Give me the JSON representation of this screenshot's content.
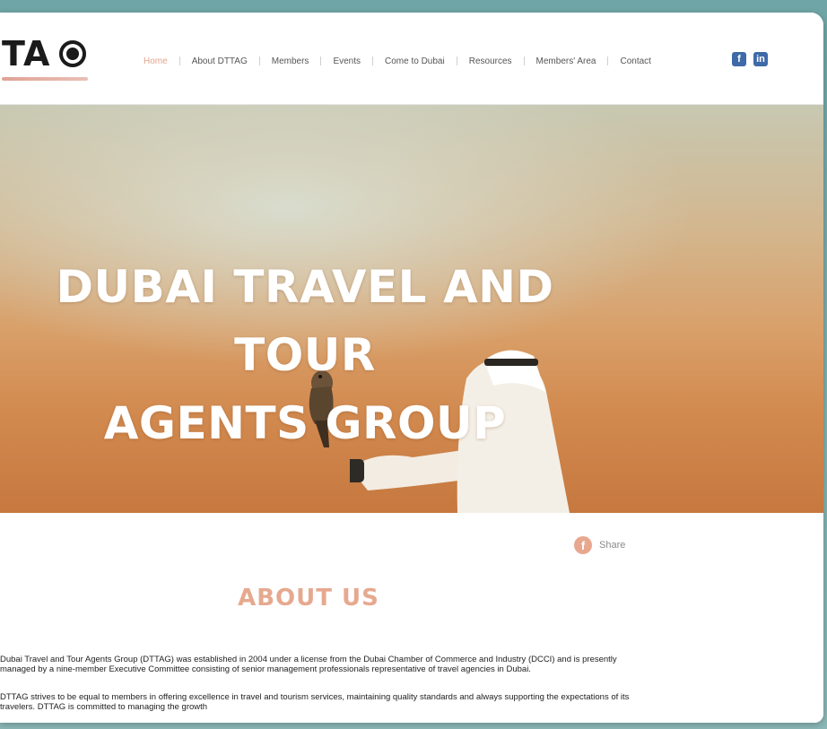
{
  "header": {
    "logo_text": "TA",
    "nav": [
      {
        "label": "Home",
        "active": true
      },
      {
        "label": "About DTTAG",
        "active": false
      },
      {
        "label": "Members",
        "active": false
      },
      {
        "label": "Events",
        "active": false
      },
      {
        "label": "Come to Dubai",
        "active": false
      },
      {
        "label": "Resources",
        "active": false
      },
      {
        "label": "Members' Area",
        "active": false
      },
      {
        "label": "Contact",
        "active": false
      }
    ],
    "social": [
      {
        "icon": "facebook-icon",
        "glyph": "f"
      },
      {
        "icon": "linkedin-icon",
        "glyph": "in"
      }
    ]
  },
  "hero": {
    "title_line1": "DUBAI TRAVEL AND TOUR",
    "title_line2": "AGENTS GROUP"
  },
  "content": {
    "share_label": "Share",
    "share_glyph": "f",
    "about_title": "ABOUT US",
    "paragraph1": "Dubai Travel and Tour Agents Group (DTTAG) was established in 2004 under a license from the Dubai Chamber of Commerce and Industry (DCCI) and is presently managed by a nine-member Executive Committee consisting of senior management professionals representative of travel agencies in Dubai.",
    "paragraph2": "DTTAG strives to be equal to members in offering excellence in travel and tourism services, maintaining quality standards and always supporting the expectations of its travelers. DTTAG is committed to managing the growth"
  },
  "colors": {
    "accent": "#e6a98f",
    "nav_text": "#555555",
    "social": "#3f6aa8",
    "background": "#8bb8b7"
  }
}
